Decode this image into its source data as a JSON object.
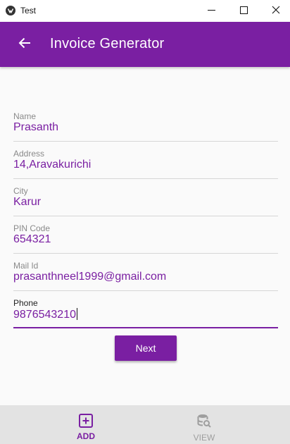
{
  "window": {
    "title": "Test"
  },
  "appbar": {
    "title": "Invoice Generator"
  },
  "form": {
    "fields": [
      {
        "label": "Name",
        "value": "Prasanth"
      },
      {
        "label": "Address",
        "value": "14,Aravakurichi"
      },
      {
        "label": "City",
        "value": "Karur"
      },
      {
        "label": "PIN Code",
        "value": "654321"
      },
      {
        "label": "Mail Id",
        "value": "prasanthneel1999@gmail.com"
      },
      {
        "label": "Phone",
        "value": "9876543210"
      }
    ],
    "next_label": "Next"
  },
  "bottom_nav": {
    "items": [
      {
        "label": "ADD",
        "icon": "add-box-icon",
        "active": true
      },
      {
        "label": "VIEW",
        "icon": "database-search-icon",
        "active": false
      }
    ]
  },
  "colors": {
    "primary": "#7a1fa2",
    "nav_background": "#e3e3e3"
  }
}
